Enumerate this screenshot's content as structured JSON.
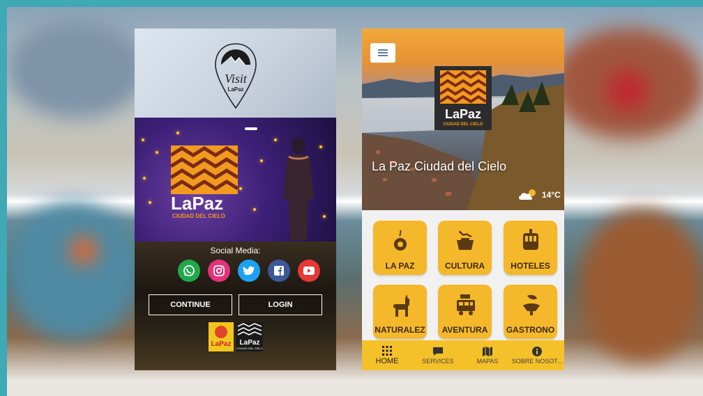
{
  "phone1": {
    "visit_logo_word": "Visit",
    "visit_logo_city": "LaPaz",
    "hero_logo_word": "LaPaz",
    "hero_logo_tagline": "CIUDAD DEL CIELO",
    "social_title": "Social Media:",
    "social_icons": [
      "whatsapp-icon",
      "instagram-icon",
      "twitter-icon",
      "facebook-icon",
      "youtube-icon"
    ],
    "continue_label": "CONTINUE",
    "login_label": "LOGIN",
    "footer_logo_left": "LaPaz",
    "footer_logo_right": "LaPaz",
    "footer_logo_right_tagline": "CIUDAD DEL CIELO"
  },
  "phone2": {
    "hero_logo_word": "LaPaz",
    "hero_logo_tagline": "CIUDAD DEL CIELO",
    "hero_title": "La Paz Ciudad del Cielo",
    "temperature": "14°C",
    "weather_icon": "partly-cloudy-icon",
    "tiles": [
      {
        "label": "LA PAZ",
        "icon": "pendant-icon"
      },
      {
        "label": "CULTURA",
        "icon": "cooking-pot-icon"
      },
      {
        "label": "HOTELES",
        "icon": "cable-car-icon"
      },
      {
        "label": "NATURALEZ",
        "icon": "llama-icon"
      },
      {
        "label": "AVENTURA",
        "icon": "bus-icon"
      },
      {
        "label": "GASTRONO",
        "icon": "dish-icon"
      }
    ],
    "nav": [
      {
        "label": "HOME",
        "icon": "grid-icon",
        "active": true
      },
      {
        "label": "SERVICES",
        "icon": "chat-icon"
      },
      {
        "label": "MAPAS",
        "icon": "map-icon"
      },
      {
        "label": "SOBRE NOSOT...",
        "icon": "info-icon"
      }
    ],
    "colors": {
      "accent": "#f5b82a",
      "nav": "#f5c129",
      "tile_text": "#3b2a10"
    }
  },
  "background": {
    "frame_color": "#3fa9b5"
  }
}
